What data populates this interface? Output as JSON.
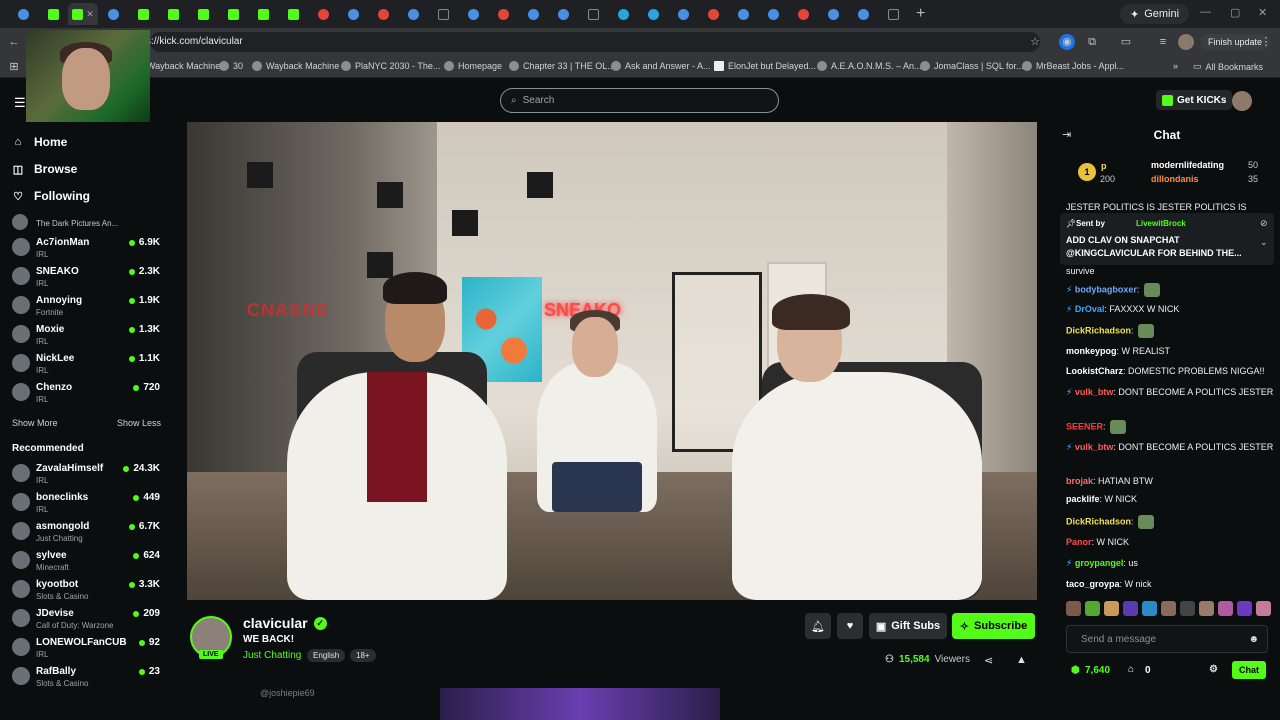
{
  "browser": {
    "url": "s://kick.com/clavicular",
    "gemini_label": "Gemini",
    "finish_update_label": "Finish update",
    "new_tab": "+",
    "bookmarks": [
      "Wayback Machine",
      "30",
      "Wayback Machine",
      "PlaNYC 2030 - The...",
      "Homepage",
      "Chapter 33 | THE OL...",
      "Ask and Answer - A...",
      "ElonJet but Delayed...",
      "A.E.A.O.N.M.S. – An...",
      "JomaClass | SQL for...",
      "MrBeast Jobs - Appl..."
    ],
    "all_bookmarks": "All Bookmarks"
  },
  "header": {
    "search_placeholder": "Search",
    "get_kicks": "Get KICKs"
  },
  "sidebar": {
    "nav": [
      {
        "label": "Home",
        "icon": "home-icon"
      },
      {
        "label": "Browse",
        "icon": "compass-icon"
      },
      {
        "label": "Following",
        "icon": "heart-icon"
      }
    ],
    "following": [
      {
        "name": "The Dark Pictures An...",
        "category": "",
        "viewers": ""
      },
      {
        "name": "Ac7ionMan",
        "category": "IRL",
        "viewers": "6.9K"
      },
      {
        "name": "SNEAKO",
        "category": "IRL",
        "viewers": "2.3K"
      },
      {
        "name": "Annoying",
        "category": "Fortnite",
        "viewers": "1.9K"
      },
      {
        "name": "Moxie",
        "category": "IRL",
        "viewers": "1.3K"
      },
      {
        "name": "NickLee",
        "category": "IRL",
        "viewers": "1.1K"
      },
      {
        "name": "Chenzo",
        "category": "IRL",
        "viewers": "720"
      }
    ],
    "show_more": "Show More",
    "show_less": "Show Less",
    "recommended_title": "Recommended",
    "recommended": [
      {
        "name": "ZavalaHimself",
        "category": "IRL",
        "viewers": "24.3K"
      },
      {
        "name": "boneclinks",
        "category": "IRL",
        "viewers": "449"
      },
      {
        "name": "asmongold",
        "category": "Just Chatting",
        "viewers": "6.7K"
      },
      {
        "name": "sylvee",
        "category": "Minecraft",
        "viewers": "624"
      },
      {
        "name": "kyootbot",
        "category": "Slots & Casino",
        "viewers": "3.3K"
      },
      {
        "name": "JDevise",
        "category": "Call of Duty: Warzone",
        "viewers": "209"
      },
      {
        "name": "LONEWOLFanCUB",
        "category": "IRL",
        "viewers": "92"
      },
      {
        "name": "RafBally",
        "category": "Slots & Casino",
        "viewers": "23"
      }
    ]
  },
  "video": {
    "neon_sign": "SNEAKO",
    "neon_left": "CNASNE"
  },
  "channel": {
    "name": "clavicular",
    "live_badge": "LIVE",
    "title": "WE BACK!",
    "category": "Just Chatting",
    "tags": [
      "English",
      "18+"
    ],
    "gift_subs": "Gift Subs",
    "subscribe": "Subscribe",
    "viewers": "15,584",
    "viewers_label": "Viewers",
    "below_user": "@joshiepie69"
  },
  "chat": {
    "title": "Chat",
    "leaderboard": {
      "rank": "1",
      "first_user": "p",
      "first_value": "200",
      "users": [
        {
          "name": "modernlifedating",
          "value": "50"
        },
        {
          "name": "dillondanis",
          "value": "35"
        }
      ]
    },
    "overflow_line": "JESTER POLITICS IS JESTER POLITICS IS",
    "pinned": {
      "sent_by_label": "Sent by",
      "sender": "LivewitBrock",
      "text_line1": "ADD CLAV ON SNAPCHAT",
      "text_line2": "@KINGCLAVICULAR FOR BEHIND THE..."
    },
    "messages": [
      {
        "user": "",
        "color": "#efeff1",
        "text": "survive"
      },
      {
        "user": "bodybagboxer",
        "color": "#6aa8ff",
        "text": ""
      },
      {
        "user": "DrOval",
        "color": "#3aa8ff",
        "text": "FAXXXX W NICK"
      },
      {
        "user": "DickRichadson",
        "color": "#f2e05a",
        "text": ""
      },
      {
        "user": "monkeypog",
        "color": "#ffffff",
        "text": "W REALIST"
      },
      {
        "user": "LookistCharz",
        "color": "#ffffff",
        "text": "DOMESTIC PROBLEMS NIGGA!!"
      },
      {
        "user": "vulk_btw",
        "color": "#ff5a5a",
        "text": "DONT BECOME A POLITICS JESTER"
      },
      {
        "user": "SEENER",
        "color": "#ff3a3a",
        "text": ""
      },
      {
        "user": "vulk_btw",
        "color": "#ff5a5a",
        "text": "DONT BECOME A POLITICS JESTER"
      },
      {
        "user": "brojak",
        "color": "#ff6a6a",
        "text": "HATIAN BTW"
      },
      {
        "user": "packlife",
        "color": "#ffffff",
        "text": "W NICK"
      },
      {
        "user": "DickRichadson",
        "color": "#f2e05a",
        "text": ""
      },
      {
        "user": "Panor",
        "color": "#ff4a4a",
        "text": "W NICK"
      },
      {
        "user": "groypangel",
        "color": "#53fc18",
        "text": "us"
      },
      {
        "user": "taco_groypa",
        "color": "#ffffff",
        "text": "W nick"
      }
    ],
    "input_placeholder": "Send a message",
    "kicks_balance": "7,640",
    "points": "0",
    "chat_button": "Chat"
  },
  "colors": {
    "accent": "#53fc18",
    "background": "#0b0e0f",
    "panel": "#2a2e31"
  }
}
